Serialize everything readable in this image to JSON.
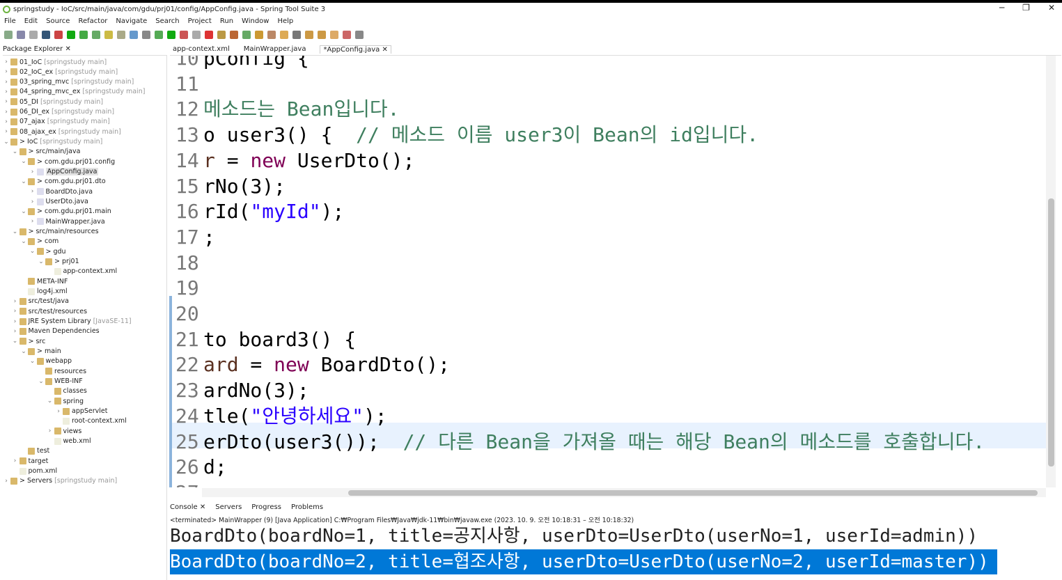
{
  "window": {
    "title": "springstudy - IoC/src/main/java/com/gdu/prj01/config/AppConfig.java - Spring Tool Suite 3",
    "controls": [
      "─",
      "❐",
      "✕"
    ]
  },
  "menu": [
    "File",
    "Edit",
    "Source",
    "Refactor",
    "Navigate",
    "Search",
    "Project",
    "Run",
    "Window",
    "Help"
  ],
  "explorer": {
    "tab": "Package Explorer",
    "tree": [
      {
        "label": "01_IoC",
        "suffix": "[springstudy main]",
        "level": 0,
        "arrow": ">"
      },
      {
        "label": "02_IoC_ex",
        "suffix": "[springstudy main]",
        "level": 0,
        "arrow": ">"
      },
      {
        "label": "03_spring_mvc",
        "suffix": "[springstudy main]",
        "level": 0,
        "arrow": ">"
      },
      {
        "label": "04_spring_mvc_ex",
        "suffix": "[springstudy main]",
        "level": 0,
        "arrow": ">"
      },
      {
        "label": "05_DI",
        "suffix": "[springstudy main]",
        "level": 0,
        "arrow": ">"
      },
      {
        "label": "06_DI_ex",
        "suffix": "[springstudy main]",
        "level": 0,
        "arrow": ">"
      },
      {
        "label": "07_ajax",
        "suffix": "[springstudy main]",
        "level": 0,
        "arrow": ">"
      },
      {
        "label": "08_ajax_ex",
        "suffix": "[springstudy main]",
        "level": 0,
        "arrow": ">"
      },
      {
        "label": "> IoC",
        "suffix": "[springstudy main]",
        "level": 0,
        "arrow": "v"
      },
      {
        "label": "> src/main/java",
        "suffix": "",
        "level": 1,
        "arrow": "v"
      },
      {
        "label": "> com.gdu.prj01.config",
        "suffix": "",
        "level": 2,
        "arrow": "v"
      },
      {
        "label": "AppConfig.java",
        "suffix": "",
        "level": 3,
        "arrow": ">",
        "selected": true
      },
      {
        "label": "> com.gdu.prj01.dto",
        "suffix": "",
        "level": 2,
        "arrow": "v"
      },
      {
        "label": "BoardDto.java",
        "suffix": "",
        "level": 3,
        "arrow": ">"
      },
      {
        "label": "UserDto.java",
        "suffix": "",
        "level": 3,
        "arrow": ">"
      },
      {
        "label": "> com.gdu.prj01.main",
        "suffix": "",
        "level": 2,
        "arrow": "v"
      },
      {
        "label": "MainWrapper.java",
        "suffix": "",
        "level": 3,
        "arrow": ">"
      },
      {
        "label": "> src/main/resources",
        "suffix": "",
        "level": 1,
        "arrow": "v"
      },
      {
        "label": "> com",
        "suffix": "",
        "level": 2,
        "arrow": "v"
      },
      {
        "label": "> gdu",
        "suffix": "",
        "level": 3,
        "arrow": "v"
      },
      {
        "label": "> prj01",
        "suffix": "",
        "level": 4,
        "arrow": "v"
      },
      {
        "label": "app-context.xml",
        "suffix": "",
        "level": 5,
        "arrow": ""
      },
      {
        "label": "META-INF",
        "suffix": "",
        "level": 2,
        "arrow": ""
      },
      {
        "label": "log4j.xml",
        "suffix": "",
        "level": 2,
        "arrow": ""
      },
      {
        "label": "src/test/java",
        "suffix": "",
        "level": 1,
        "arrow": ">"
      },
      {
        "label": "src/test/resources",
        "suffix": "",
        "level": 1,
        "arrow": ">"
      },
      {
        "label": "JRE System Library",
        "suffix": "[JavaSE-11]",
        "level": 1,
        "arrow": ">"
      },
      {
        "label": "Maven Dependencies",
        "suffix": "",
        "level": 1,
        "arrow": ">"
      },
      {
        "label": "> src",
        "suffix": "",
        "level": 1,
        "arrow": "v"
      },
      {
        "label": "> main",
        "suffix": "",
        "level": 2,
        "arrow": "v"
      },
      {
        "label": "webapp",
        "suffix": "",
        "level": 3,
        "arrow": "v"
      },
      {
        "label": "resources",
        "suffix": "",
        "level": 4,
        "arrow": ""
      },
      {
        "label": "WEB-INF",
        "suffix": "",
        "level": 4,
        "arrow": "v"
      },
      {
        "label": "classes",
        "suffix": "",
        "level": 5,
        "arrow": ""
      },
      {
        "label": "spring",
        "suffix": "",
        "level": 5,
        "arrow": "v"
      },
      {
        "label": "appServlet",
        "suffix": "",
        "level": 6,
        "arrow": ">"
      },
      {
        "label": "root-context.xml",
        "suffix": "",
        "level": 6,
        "arrow": ""
      },
      {
        "label": "views",
        "suffix": "",
        "level": 5,
        "arrow": ">"
      },
      {
        "label": "web.xml",
        "suffix": "",
        "level": 5,
        "arrow": ""
      },
      {
        "label": "test",
        "suffix": "",
        "level": 2,
        "arrow": ""
      },
      {
        "label": "target",
        "suffix": "",
        "level": 1,
        "arrow": ">"
      },
      {
        "label": "pom.xml",
        "suffix": "",
        "level": 1,
        "arrow": ""
      },
      {
        "label": "> Servers",
        "suffix": "[springstudy main]",
        "level": 0,
        "arrow": ">"
      }
    ]
  },
  "editor": {
    "tabs": [
      "app-context.xml",
      "MainWrapper.java",
      "*AppConfig.java"
    ],
    "lines": [
      {
        "n": "10",
        "segs": [
          [
            "pConfig {",
            "pl"
          ]
        ]
      },
      {
        "n": "11",
        "segs": []
      },
      {
        "n": "12",
        "segs": [
          [
            "메소드는 Bean입니다.",
            "cmt"
          ]
        ]
      },
      {
        "n": "13",
        "segs": [
          [
            "o user3() {  ",
            "pl"
          ],
          [
            "// 메소드 이름 user3이 Bean의 id입니다.",
            "cmt"
          ]
        ]
      },
      {
        "n": "14",
        "segs": [
          [
            "r",
            "fld"
          ],
          [
            " = ",
            "pl"
          ],
          [
            "new",
            "kw"
          ],
          [
            " UserDto();",
            "pl"
          ]
        ]
      },
      {
        "n": "15",
        "segs": [
          [
            "rNo(3);",
            "pl"
          ]
        ]
      },
      {
        "n": "16",
        "segs": [
          [
            "rId(",
            "pl"
          ],
          [
            "\"myId\"",
            "str"
          ],
          [
            ");",
            "pl"
          ]
        ]
      },
      {
        "n": "17",
        "segs": [
          [
            ";",
            "pl"
          ]
        ]
      },
      {
        "n": "18",
        "segs": []
      },
      {
        "n": "19",
        "segs": []
      },
      {
        "n": "20",
        "segs": []
      },
      {
        "n": "21",
        "segs": [
          [
            "to board3() {",
            "pl"
          ]
        ]
      },
      {
        "n": "22",
        "segs": [
          [
            "ard",
            "fld"
          ],
          [
            " = ",
            "pl"
          ],
          [
            "new",
            "kw"
          ],
          [
            " BoardDto();",
            "pl"
          ]
        ]
      },
      {
        "n": "23",
        "segs": [
          [
            "ardNo(3);",
            "pl"
          ]
        ]
      },
      {
        "n": "24",
        "segs": [
          [
            "tle(",
            "pl"
          ],
          [
            "\"안녕하세요\"",
            "str"
          ],
          [
            ");",
            "pl"
          ]
        ]
      },
      {
        "n": "25",
        "segs": [
          [
            "erDto(user3());  ",
            "pl"
          ],
          [
            "// 다른 Bean을 가져올 때는 해당 Bean의 메소드를 호출합니다.",
            "cmt"
          ]
        ]
      },
      {
        "n": "26",
        "segs": [
          [
            "d;",
            "pl"
          ]
        ]
      },
      {
        "n": "27",
        "segs": []
      }
    ]
  },
  "console": {
    "tabs": [
      "Console",
      "Servers",
      "Progress",
      "Problems"
    ],
    "info": "<terminated> MainWrapper (9) [Java Application] C:₩Program Files₩Java₩jdk-11₩bin₩javaw.exe  (2023. 10. 9. 오전 10:18:31 – 오전 10:18:32)",
    "output": [
      "BoardDto(boardNo=1, title=공지사항, userDto=UserDto(userNo=1, userId=admin))",
      "BoardDto(boardNo=2, title=협조사항, userDto=UserDto(userNo=2, userId=master))"
    ]
  }
}
